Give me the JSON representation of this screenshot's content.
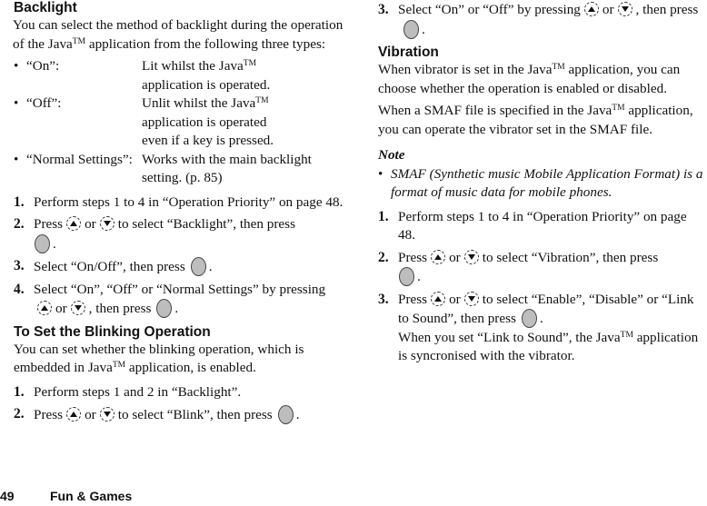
{
  "left": {
    "backlight": {
      "heading": "Backlight",
      "intro_1": "You can select the method of backlight during the operation of the Java",
      "tm": "TM",
      "intro_2": " application from the following three types:",
      "types": [
        {
          "key": "“On”:",
          "line1": "Lit whilst the Java",
          "tm": "TM",
          "line2": "application is operated."
        },
        {
          "key": "“Off”:",
          "line1": "Unlit whilst the Java",
          "tm": "TM",
          "line2": "application is operated",
          "line3": "even if a key is pressed."
        },
        {
          "key": "“Normal Settings”:",
          "line1": "Works with the main backlight",
          "line2": "setting. (p. 85)"
        }
      ],
      "steps": [
        {
          "num": "1.",
          "text": "Perform steps 1 to 4 in “Operation Priority” on page 48."
        },
        {
          "num": "2.",
          "pre": "Press",
          "mid": "or",
          "post": "to select “Backlight”, then press",
          "end": "."
        },
        {
          "num": "3.",
          "pre": "Select “On/Off”, then press",
          "end": "."
        },
        {
          "num": "4.",
          "pre": "Select “On”, “Off” or “Normal Settings” by pressing",
          "mid": "or",
          "post": ", then press",
          "end": "."
        }
      ]
    },
    "blinking": {
      "heading": "To Set the Blinking Operation",
      "intro_1": "You can set whether the blinking operation, which is embedded in Java",
      "tm": "TM",
      "intro_2": " application, is enabled.",
      "steps": [
        {
          "num": "1.",
          "text": "Perform steps 1 and 2 in “Backlight”."
        },
        {
          "num": "2.",
          "pre": "Press",
          "mid": "or",
          "post": "to select “Blink”, then press",
          "end": "."
        }
      ]
    }
  },
  "right": {
    "blink_step3": {
      "num": "3.",
      "pre": "Select “On” or “Off” by pressing",
      "mid": "or",
      "post": ", then press",
      "end": "."
    },
    "vibration": {
      "heading": "Vibration",
      "p1_1": "When vibrator is set in the Java",
      "tm": "TM",
      "p1_2": " application, you can choose whether the operation is enabled or disabled.",
      "p2_1": "When a SMAF file is specified in the Java",
      "p2_2": " application, you can operate the vibrator set in the SMAF file.",
      "note_title": "Note",
      "note_text": "SMAF (Synthetic music Mobile Application Format) is a format of music data for mobile phones.",
      "steps": [
        {
          "num": "1.",
          "text": "Perform steps 1 to 4 in “Operation Priority” on page 48."
        },
        {
          "num": "2.",
          "pre": "Press",
          "mid": "or",
          "post": "to select “Vibration”, then press",
          "end": "."
        },
        {
          "num": "3.",
          "pre": "Press",
          "mid": "or",
          "post": "to select “Enable”, “Disable” or “Link to Sound”, then press",
          "end": ".",
          "extra_1": "When you set “Link to Sound”, the Java",
          "extra_2": " application is syncronised with the vibrator."
        }
      ]
    }
  },
  "footer": {
    "page_number": "49",
    "section": "Fun & Games"
  },
  "colors": {
    "center_key_fill": "#bdbdbd",
    "text": "#111111"
  }
}
